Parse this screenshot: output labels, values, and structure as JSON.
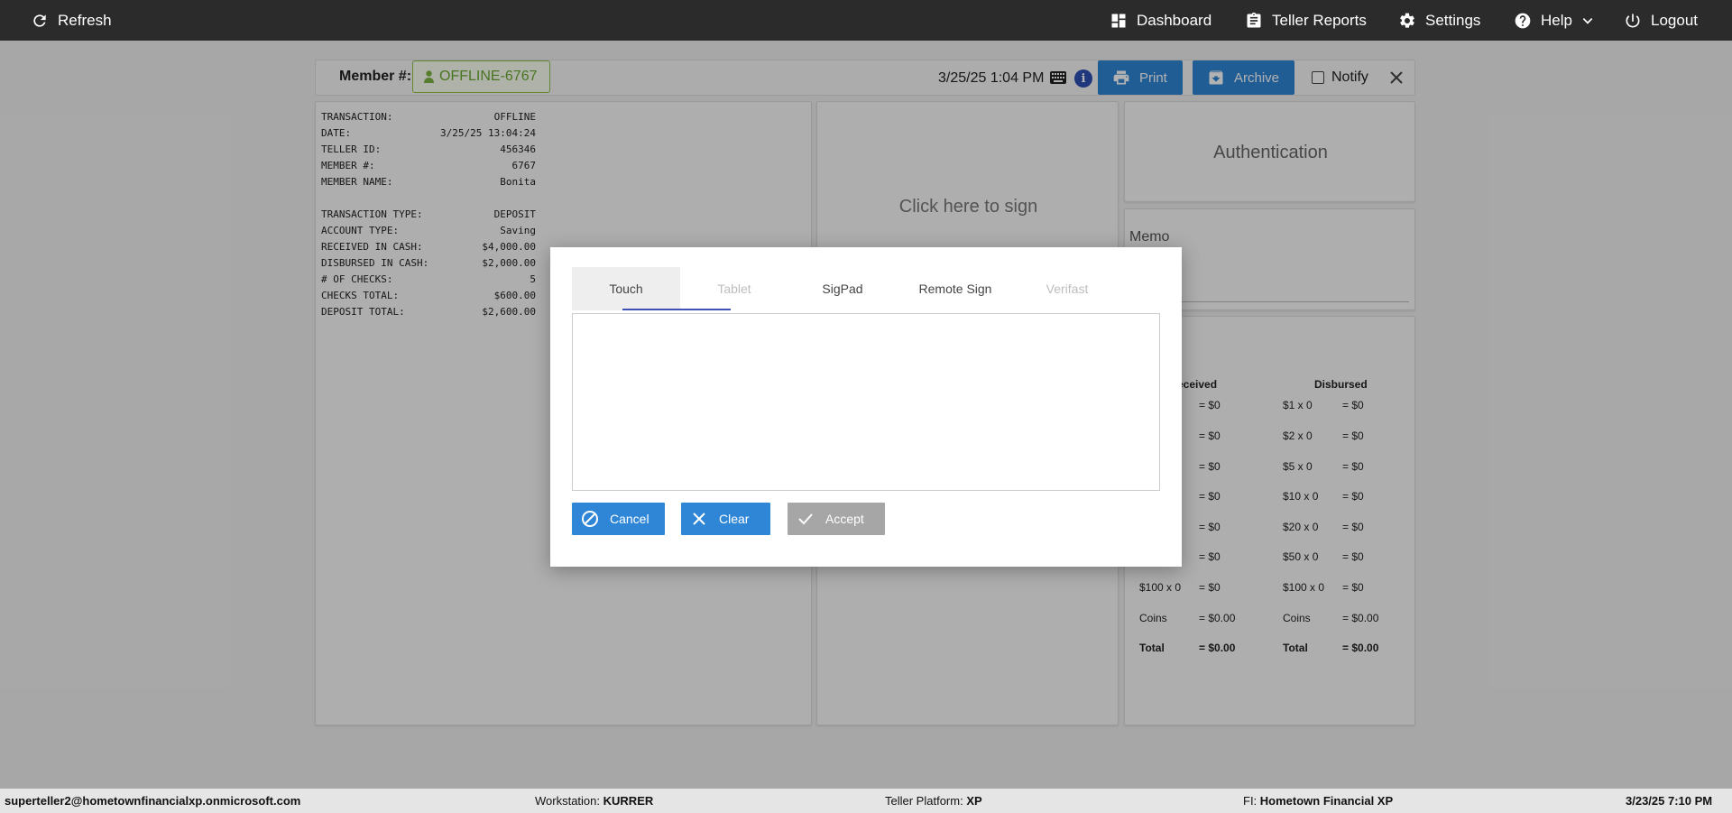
{
  "topnav": {
    "refresh": "Refresh",
    "dashboard": "Dashboard",
    "teller_reports": "Teller Reports",
    "settings": "Settings",
    "help": "Help",
    "logout": "Logout"
  },
  "header": {
    "member_label": "Member #:",
    "member_value": "OFFLINE-6767",
    "datetime": "3/25/25 1:04 PM",
    "print": "Print",
    "archive": "Archive",
    "notify": "Notify"
  },
  "receipt": [
    [
      "TRANSACTION:",
      "OFFLINE"
    ],
    [
      "DATE:",
      "3/25/25 13:04:24"
    ],
    [
      "TELLER ID:",
      "456346"
    ],
    [
      "MEMBER #:",
      "6767"
    ],
    [
      "MEMBER NAME:",
      "Bonita"
    ],
    null,
    [
      "TRANSACTION TYPE:",
      "DEPOSIT"
    ],
    [
      "ACCOUNT TYPE:",
      "Saving"
    ],
    [
      "RECEIVED IN CASH:",
      "$4,000.00"
    ],
    [
      "DISBURSED IN CASH:",
      "$2,000.00"
    ],
    [
      "# OF CHECKS:",
      "5"
    ],
    [
      "CHECKS TOTAL:",
      "$600.00"
    ],
    [
      "DEPOSIT TOTAL:",
      "$2,600.00"
    ]
  ],
  "signature": {
    "prompt": "Click here to sign"
  },
  "authentication": {
    "label": "Authentication"
  },
  "memo": {
    "label": "Memo"
  },
  "cash": {
    "received_head": "eceived",
    "disbursed_head": "Disbursed",
    "received_rows": [
      {
        "label": "",
        "value": "= $0"
      },
      {
        "label": "",
        "value": "= $0"
      },
      {
        "label": "",
        "value": "= $0"
      },
      {
        "label": "",
        "value": "= $0"
      },
      {
        "label": "",
        "value": "= $0"
      },
      {
        "label": "",
        "value": "= $0"
      },
      {
        "label": "$100 x 0",
        "value": "= $0"
      },
      {
        "label": "Coins",
        "value": "= $0.00"
      },
      {
        "label": "Total",
        "value": "= $0.00"
      }
    ],
    "disbursed_rows": [
      {
        "label": "$1 x 0",
        "value": "= $0"
      },
      {
        "label": "$2 x 0",
        "value": "= $0"
      },
      {
        "label": "$5 x 0",
        "value": "= $0"
      },
      {
        "label": "$10 x 0",
        "value": "= $0"
      },
      {
        "label": "$20 x 0",
        "value": "= $0"
      },
      {
        "label": "$50 x 0",
        "value": "= $0"
      },
      {
        "label": "$100 x 0",
        "value": "= $0"
      },
      {
        "label": "Coins",
        "value": "= $0.00"
      },
      {
        "label": "Total",
        "value": "= $0.00"
      }
    ]
  },
  "modal": {
    "tabs": [
      "Touch",
      "Tablet",
      "SigPad",
      "Remote Sign",
      "Verifast"
    ],
    "active_tab": "Touch",
    "disabled_tabs": [
      "Tablet",
      "Verifast"
    ],
    "cancel": "Cancel",
    "clear": "Clear",
    "accept": "Accept"
  },
  "footer": {
    "user": "superteller2@hometownfinancialxp.onmicrosoft.com",
    "workstation_label": "Workstation:",
    "workstation": "KURRER",
    "platform_label": "Teller Platform:",
    "platform": "XP",
    "fi_label": "FI:",
    "fi": "Hometown Financial XP",
    "datetime": "3/23/25 7:10 PM"
  },
  "colors": {
    "nav_bg": "#2b2b2b",
    "primary": "#2f86d6",
    "member_green": "#6aa82f",
    "tab_underline": "#3f51b5",
    "disabled_button": "#a6a6a6"
  }
}
